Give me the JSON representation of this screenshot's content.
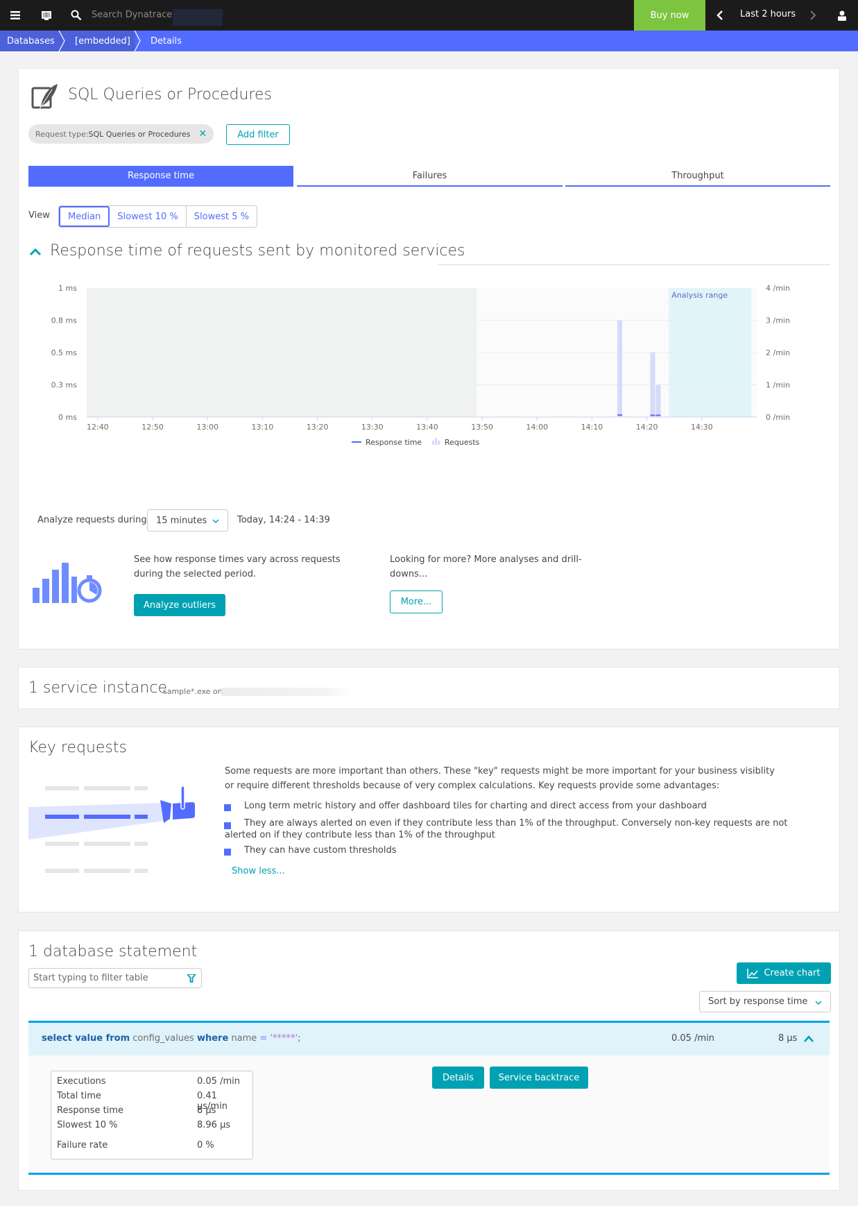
{
  "topbar": {
    "menu_icon": "hamburger-menu-icon",
    "screen_icon": "screen-icon",
    "search_icon": "search-icon",
    "search_placeholder": "Search Dynatrace:",
    "buy_label": "Buy now",
    "timeframe": "Last 2 hours",
    "prev_icon": "chevron-left-icon",
    "next_icon": "chevron-right-icon",
    "user_icon": "user-icon"
  },
  "breadcrumb": [
    "Databases",
    "[embedded]",
    "Details"
  ],
  "header": {
    "title": "SQL Queries or Procedures",
    "icon": "sql-quill-icon",
    "filter_key": "Request type: ",
    "filter_value": "SQL Queries or Procedures",
    "add_filter": "Add filter"
  },
  "tabs": [
    {
      "label": "Response time",
      "active": true
    },
    {
      "label": "Failures",
      "active": false
    },
    {
      "label": "Throughput",
      "active": false
    }
  ],
  "view": {
    "label": "View",
    "options": [
      "Median",
      "Slowest 10 %",
      "Slowest 5 %"
    ],
    "selected": "Median"
  },
  "chart_section": {
    "title": "Response time of requests sent by monitored services"
  },
  "chart_data": {
    "type": "bar",
    "title": "Response time of requests sent by monitored services",
    "x": [
      "12:40",
      "12:50",
      "13:00",
      "13:10",
      "13:20",
      "13:30",
      "13:40",
      "13:50",
      "14:00",
      "14:10",
      "14:20",
      "14:30"
    ],
    "y_left_ticks": [
      "0 ms",
      "0.3 ms",
      "0.5 ms",
      "0.8 ms",
      "1 ms"
    ],
    "y_right_ticks": [
      "0 /min",
      "1 /min",
      "2 /min",
      "3 /min",
      "4 /min"
    ],
    "y_left_range_ms": [
      0,
      1
    ],
    "y_right_range_per_min": [
      0,
      4
    ],
    "no_data_until": "13:49",
    "analysis_range": {
      "label": "Analysis range",
      "from": "14:24",
      "to": "14:39"
    },
    "series": [
      {
        "name": "Requests",
        "type": "bar",
        "points": [
          {
            "t": "14:15",
            "value": 3
          },
          {
            "t": "14:21",
            "value": 2
          },
          {
            "t": "14:22",
            "value": 1
          }
        ]
      },
      {
        "name": "Response time",
        "type": "line",
        "points": [
          {
            "t": "14:15",
            "value_ms": 0.01
          },
          {
            "t": "14:21",
            "value_ms": 0.008
          },
          {
            "t": "14:22",
            "value_ms": 0.008
          }
        ]
      }
    ],
    "legend": [
      "Response time",
      "Requests"
    ],
    "legend_position": "bottom-center"
  },
  "analyze": {
    "label": "Analyze requests during",
    "duration": "15 minutes",
    "range_text": "Today, 14:24 - 14:39",
    "outliers_text": "See how response times vary across requests during the selected period.",
    "outliers_button": "Analyze outliers",
    "more_text": "Looking for more? More analyses and drill-downs...",
    "more_button": "More..."
  },
  "service_instance": {
    "title": "1 service instance",
    "detail": "sample*.exe on"
  },
  "key_requests": {
    "title": "Key requests",
    "intro": "Some requests are more important than others. These \"key\" requests might be more important for your business visiblity or require different thresholds because of very complex calculations. Key requests provide some advantages:",
    "bullets": [
      "Long term metric history and offer dashboard tiles for charting and direct access from your dashboard",
      "They are always alerted on even if they contribute less than 1% of the throughput. Conversely non-key requests are not alerted on if they contribute less than 1% of the throughput",
      "They can have custom thresholds"
    ],
    "show_less": "Show less..."
  },
  "db_statements": {
    "title": "1 database statement",
    "filter_placeholder": "Start typing to filter table",
    "create_chart": "Create chart",
    "sort": "Sort by response time",
    "rows": [
      {
        "sql": {
          "kw1": "select value from",
          "t1": " config_values ",
          "kw2": "where",
          "t2": " name ",
          "op": "=",
          "lit": " '*****'",
          "end": ";"
        },
        "rate": "0.05 /min",
        "response": "8 µs",
        "stats": [
          {
            "label": "Executions",
            "value": "0.05 /min"
          },
          {
            "label": "Total time",
            "value": "0.41 µs/min"
          },
          {
            "label": "Response time",
            "value": "8 µs"
          },
          {
            "label": "Slowest 10 %",
            "value": "8.96 µs"
          },
          {
            "label": "Failure rate",
            "value": "0 %"
          }
        ],
        "details_button": "Details",
        "backtrace_button": "Service backtrace"
      }
    ]
  }
}
